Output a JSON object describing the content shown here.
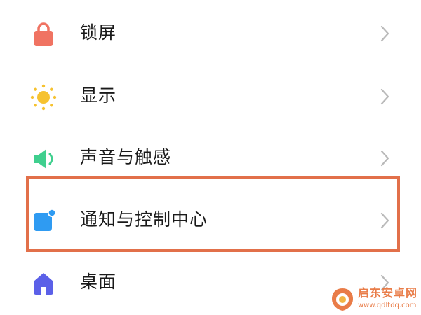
{
  "settings": {
    "items": [
      {
        "label": "锁屏",
        "icon": "lock-icon",
        "icon_color": "#f07362"
      },
      {
        "label": "显示",
        "icon": "sun-icon",
        "icon_color": "#f6c230"
      },
      {
        "label": "声音与触感",
        "icon": "speaker-icon",
        "icon_color": "#3fcf8e"
      },
      {
        "label": "通知与控制中心",
        "icon": "notification-icon",
        "icon_color": "#2f9bf2"
      },
      {
        "label": "桌面",
        "icon": "home-icon",
        "icon_color": "#5b60e8"
      }
    ],
    "chevron_icon": "chevron-right-icon",
    "chevron_color": "#b9b9b9"
  },
  "highlight": {
    "color": "#e2704a"
  },
  "watermark": {
    "title": "启东安卓网",
    "url": "www.qdltdq.com",
    "color": "#e8763f"
  }
}
